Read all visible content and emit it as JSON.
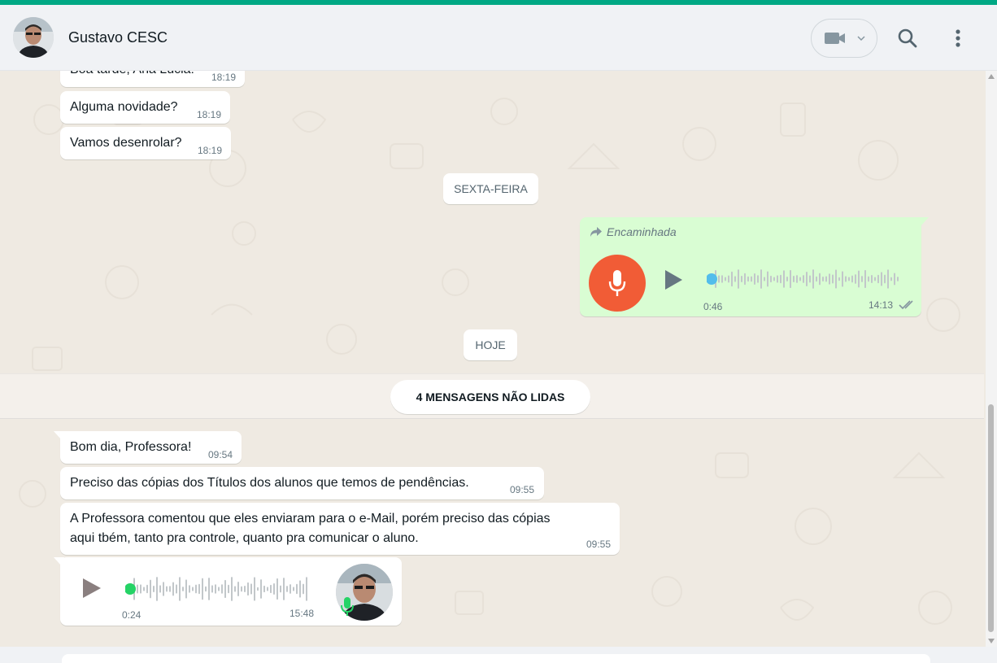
{
  "colors": {
    "accent": "#00a884",
    "outgoing_bubble": "#d9fdd3",
    "incoming_bubble": "#ffffff",
    "chat_background": "#efeae2",
    "voice_mic": "#f15c36",
    "audio_dot_outgoing": "#53bdeb",
    "audio_dot_incoming": "#25d366"
  },
  "header": {
    "contact_name": "Gustavo CESC",
    "avatar_icon": "contact-avatar",
    "video_icon": "video-camera-icon",
    "search_icon": "search-icon",
    "menu_icon": "more-vertical-icon"
  },
  "messages_before": [
    {
      "text": "Boa tarde, Ana Lúcia!",
      "time": "18:19"
    },
    {
      "text": "Alguma novidade?",
      "time": "18:19"
    },
    {
      "text": "Vamos desenrolar?",
      "time": "18:19"
    }
  ],
  "date_separators": {
    "friday": "SEXTA-FEIRA",
    "today": "HOJE"
  },
  "forwarded_audio": {
    "forwarded_label": "Encaminhada",
    "duration": "0:46",
    "time": "14:13",
    "status_icon": "double-check-icon",
    "progress": 0
  },
  "unread_banner": "4 MENSAGENS NÃO LIDAS",
  "messages_today": [
    {
      "text": "Bom dia, Professora!",
      "time": "09:54"
    },
    {
      "text": "Preciso das cópias dos Títulos dos alunos que temos de pendências.",
      "time": "09:55"
    },
    {
      "line1": "A Professora comentou que eles enviaram para o e-Mail, porém preciso das cópias",
      "line2": "aqui tbém, tanto pra controle, quanto pra comunicar o aluno.",
      "time": "09:55"
    }
  ],
  "incoming_audio": {
    "duration": "0:24",
    "time": "15:48",
    "progress": 0
  }
}
